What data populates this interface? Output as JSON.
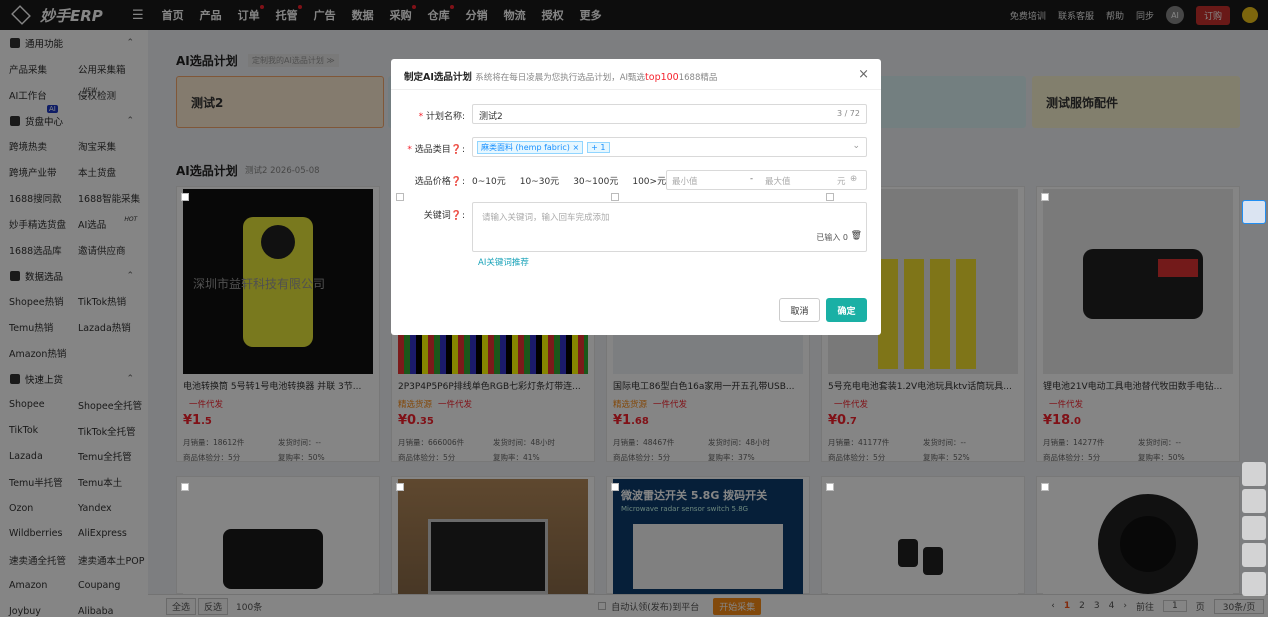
{
  "app": {
    "logo": "妙手ERP",
    "menu_icon": "☰"
  },
  "nav": {
    "items": [
      {
        "label": "首页",
        "dot": false
      },
      {
        "label": "产品",
        "dot": false
      },
      {
        "label": "订单",
        "dot": true
      },
      {
        "label": "托管",
        "dot": true
      },
      {
        "label": "广告",
        "dot": false
      },
      {
        "label": "数据",
        "dot": false
      },
      {
        "label": "采购",
        "dot": true
      },
      {
        "label": "仓库",
        "dot": true
      },
      {
        "label": "分销",
        "dot": false
      },
      {
        "label": "物流",
        "dot": false
      },
      {
        "label": "授权",
        "dot": false
      },
      {
        "label": "更多",
        "dot": false
      }
    ]
  },
  "topright": {
    "training": "免费培训",
    "service": "联系客服",
    "help": "帮助",
    "sync": "同步",
    "ai": "AI",
    "subscribe": "订购"
  },
  "sidebar": {
    "sec1": "通用功能",
    "r1": [
      "产品采集",
      "公用采集箱"
    ],
    "r2": [
      "AI工作台",
      "侵权检测"
    ],
    "r2_badge": "NEW",
    "sec2": "货盘中心",
    "sec2_badge": "AI",
    "r3": [
      "跨境热卖",
      "淘宝采集"
    ],
    "r4": [
      "跨境产业带",
      "本土货盘"
    ],
    "r5": [
      "1688搜同款",
      "1688智能采集"
    ],
    "r6": [
      "妙手精选货盘",
      "AI选品"
    ],
    "r6_badge": "HOT",
    "r7": [
      "1688选品库",
      "邀请供应商"
    ],
    "sec3": "数据选品",
    "r8": [
      "Shopee热销",
      "TikTok热销"
    ],
    "r9": [
      "Temu热销",
      "Lazada热销"
    ],
    "r10": [
      "Amazon热销",
      ""
    ],
    "sec4": "快速上货",
    "r11": [
      "Shopee",
      "Shopee全托管"
    ],
    "r12": [
      "TikTok",
      "TikTok全托管"
    ],
    "r13": [
      "Lazada",
      "Temu全托管"
    ],
    "r14": [
      "Temu半托管",
      "Temu本土"
    ],
    "r15": [
      "Ozon",
      "Yandex"
    ],
    "r16": [
      "Wildberries",
      "AliExpress"
    ],
    "r17": [
      "速卖通全托管",
      "速卖通本土POP"
    ],
    "r18": [
      "Amazon",
      "Coupang"
    ],
    "r19": [
      "Joybuy",
      "Alibaba"
    ]
  },
  "main": {
    "title": "AI选品计划",
    "title_tag": "定制我的AI选品计划 ≫",
    "plans": [
      "测试2",
      "测试服饰配件"
    ],
    "section": "AI选品计划",
    "section_sub": "测试2 2026-05-08",
    "products": [
      {
        "title": "电池转换筒 5号转1号电池转换器 并联 3节...",
        "tag1": "",
        "tag2": "一件代发",
        "p_int": "¥1",
        "p_dec": ".5",
        "sales": "月销量：18612件",
        "ship": "发货时间：--",
        "score": "商品体验分：5分",
        "rep": "复购率：50%",
        "watermark": "深圳市益轩科技有限公司"
      },
      {
        "title": "2P3P4P5P6P排线单色RGB七彩灯条灯带连...",
        "tag1": "精选货源",
        "tag2": "一件代发",
        "p_int": "¥0",
        "p_dec": ".35",
        "sales": "月销量：666006件",
        "ship": "发货时间：48小时",
        "score": "商品体验分：5分",
        "rep": "复购率：41%",
        "watermark": ""
      },
      {
        "title": "国际电工86型白色16a家用一开五孔带USB...",
        "tag1": "精选货源",
        "tag2": "一件代发",
        "p_int": "¥1",
        "p_dec": ".68",
        "sales": "月销量：48467件",
        "ship": "发货时间：48小时",
        "score": "商品体验分：5分",
        "rep": "复购率：37%",
        "watermark": ""
      },
      {
        "title": "5号充电电池套装1.2V电池玩具ktv话筒玩具...",
        "tag1": "",
        "tag2": "一件代发",
        "p_int": "¥0",
        "p_dec": ".7",
        "sales": "月销量：41177件",
        "ship": "发货时间：--",
        "score": "商品体验分：5分",
        "rep": "复购率：52%",
        "watermark": ""
      },
      {
        "title": "锂电池21V电动工具电池替代牧田数手电钻...",
        "tag1": "",
        "tag2": "一件代发",
        "p_int": "¥18",
        "p_dec": ".0",
        "sales": "月销量：14277件",
        "ship": "发货时间：--",
        "score": "商品体验分：5分",
        "rep": "复购率：50%",
        "watermark": ""
      }
    ],
    "radar_text": "微波雷达开关 5.8G 拨码开关",
    "radar_sub": "Microwave radar sensor switch 5.8G",
    "bottom": {
      "select_all": "全选",
      "invert": "反选",
      "count": "100条",
      "auto": "自动认领(发布)到平台",
      "start": "开始采集",
      "pages": [
        "1",
        "2",
        "3",
        "4"
      ],
      "prev": "‹",
      "next": "›",
      "goto": "前往",
      "page_val": "1",
      "page_unit": "页",
      "per_page": "30条/页"
    }
  },
  "modal": {
    "title": "制定AI选品计划",
    "subtitle": "系统将在每日凌晨为您执行选品计划，AI甄选",
    "highlight": "top100",
    "subtitle2": "1688精品",
    "close": "×",
    "name_label": "计划名称:",
    "name_value": "测试2",
    "name_count": "3 / 72",
    "cat_label": "选品类目",
    "cat_chip": "麻类面料 (hemp fabric) ×",
    "cat_more": "+ 1",
    "price_label": "选品价格",
    "price_opts": [
      "0~10元",
      "10~30元",
      "30~100元",
      "100>元"
    ],
    "min_ph": "最小值",
    "max_ph": "最大值",
    "unit": "元",
    "kw_label": "关键词",
    "kw_ph": "请输入关键词，输入回车完成添加",
    "kw_count": "已输入 0",
    "kw_ai": "AI关键词推荐",
    "cancel": "取消",
    "ok": "确定"
  }
}
